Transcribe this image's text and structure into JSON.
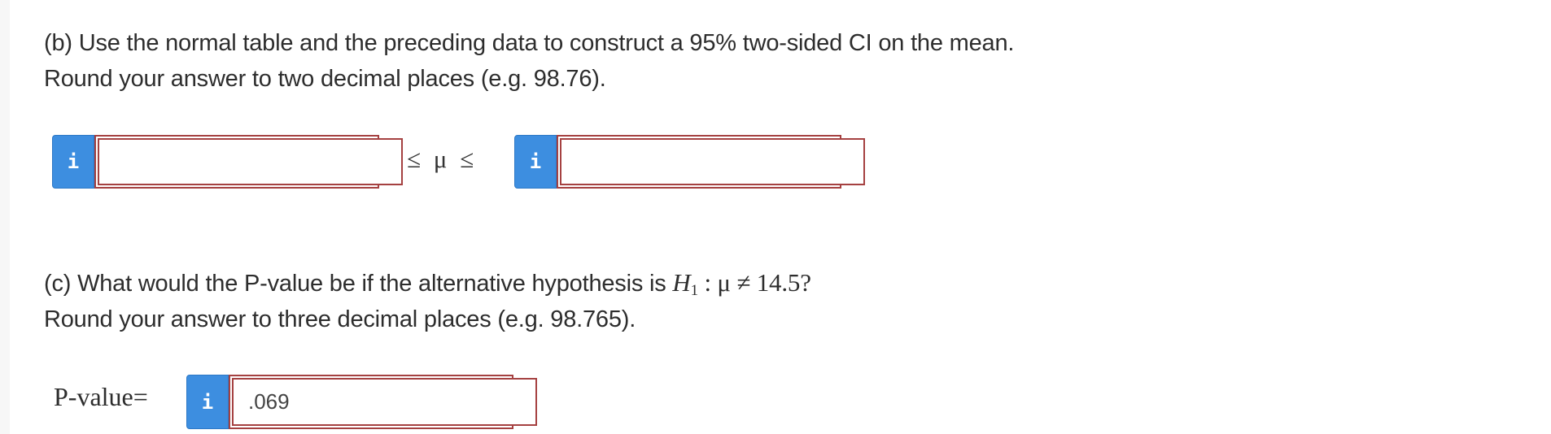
{
  "part_b": {
    "line1": "(b) Use the normal table and the preceding data to construct a 95% two-sided CI on the mean.",
    "line2": "Round your answer to two decimal places (e.g. 98.76).",
    "info_icon": "i",
    "lower_bound_value": "",
    "upper_bound_value": "",
    "inequality": "≤ μ ≤"
  },
  "part_c": {
    "line1_prefix": "(c) What would the P-value be if the alternative hypothesis is ",
    "hyp_H": "H",
    "hyp_sub": "1",
    "hyp_rest": " : μ ≠ 14.5?",
    "line2": "Round your answer to three decimal places (e.g. 98.765).",
    "pvalue_label": "P-value=",
    "info_icon": "i",
    "pvalue_value": ".069"
  },
  "colors": {
    "info_button": "#3d8ee0",
    "field_border": "#a54141"
  }
}
